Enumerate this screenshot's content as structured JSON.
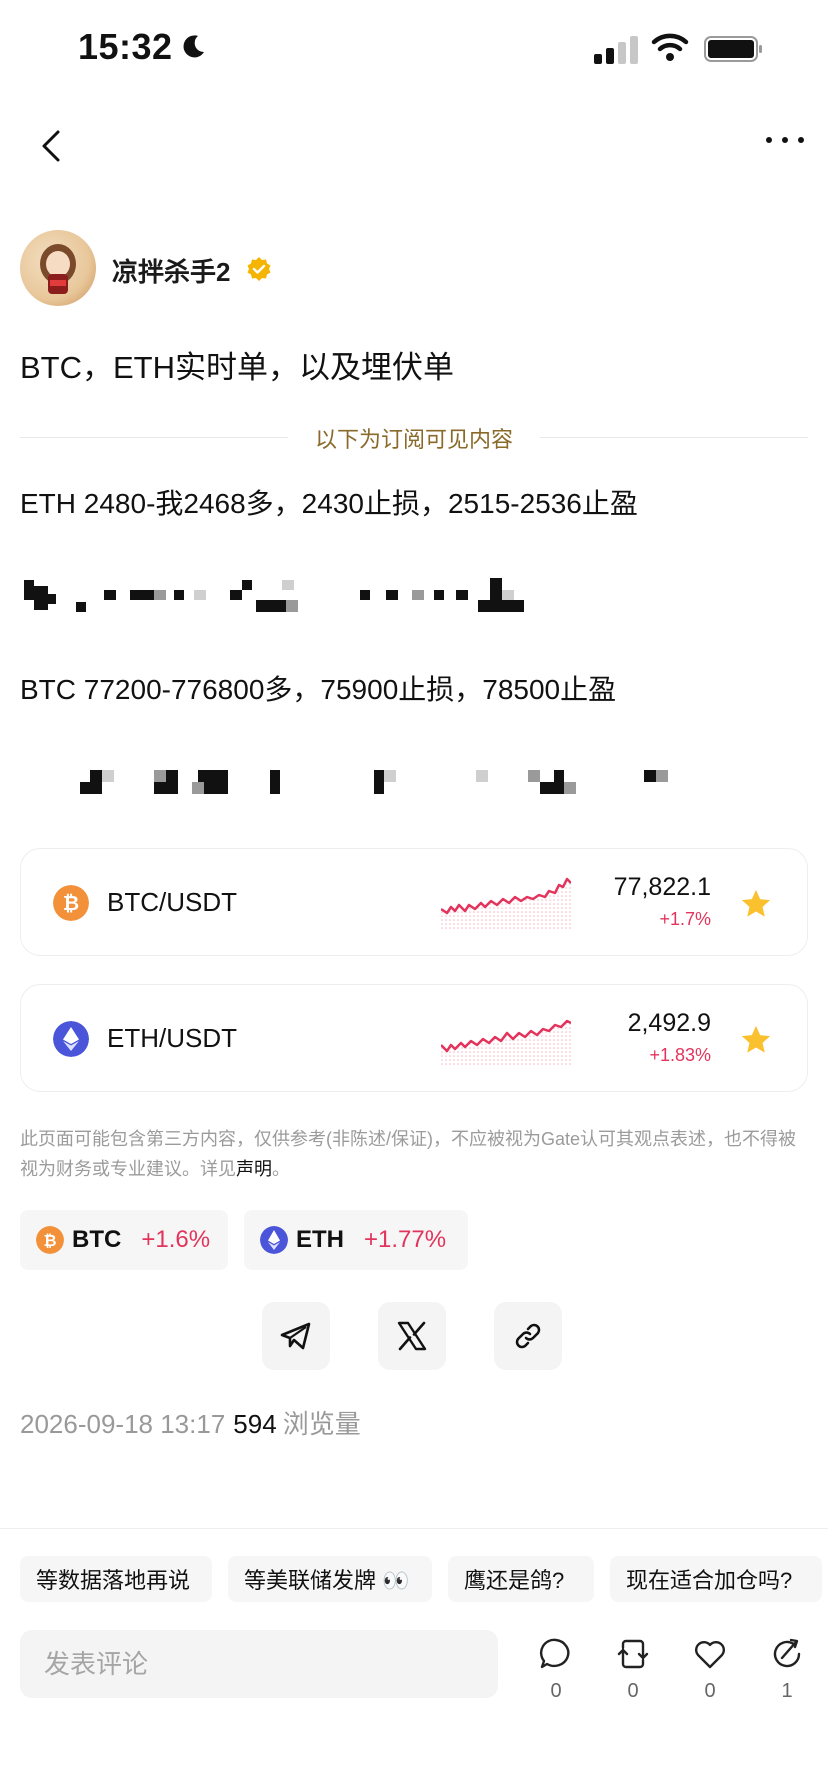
{
  "status_bar": {
    "time": "15:32"
  },
  "author": {
    "name": "凉拌杀手2"
  },
  "post": {
    "title": "BTC，ETH实时单，以及埋伏单",
    "divider_text": "以下为订阅可见内容",
    "line1": "ETH 2480-我2468多，2430止损，2515-2536止盈",
    "line2": "BTC 77200-776800多，75900止损，78500止盈"
  },
  "markets": [
    {
      "pair": "BTC/USDT",
      "price": "77,822.1",
      "change": "+1.7%",
      "icon": "bitcoin-icon",
      "color": "#f2913a"
    },
    {
      "pair": "ETH/USDT",
      "price": "2,492.9",
      "change": "+1.83%",
      "icon": "ethereum-icon",
      "color": "#4a55d9"
    }
  ],
  "disclaimer": {
    "text": "此页面可能包含第三方内容，仅供参考(非陈述/保证)，不应被视为Gate认可其观点表述，也不得被视为财务或专业建议。详见",
    "link": "声明",
    "end": "。"
  },
  "coin_chips": [
    {
      "symbol": "BTC",
      "change": "+1.6%"
    },
    {
      "symbol": "ETH",
      "change": "+1.77%"
    }
  ],
  "meta": {
    "date": "2026-09-18 13:17",
    "views": "594",
    "views_label": "浏览量"
  },
  "tags": [
    "等数据落地再说",
    "等美联储发牌 👀",
    "鹰还是鸽?",
    "现在适合加仓吗?"
  ],
  "comment": {
    "placeholder": "发表评论"
  },
  "actions": [
    {
      "icon": "comment-icon",
      "count": "0"
    },
    {
      "icon": "repost-icon",
      "count": "0"
    },
    {
      "icon": "like-icon",
      "count": "0"
    },
    {
      "icon": "share-icon",
      "count": "1"
    }
  ],
  "colors": {
    "accent_up": "#e2345c",
    "divider_text": "#8a6a2a",
    "star": "#fbc02d"
  }
}
